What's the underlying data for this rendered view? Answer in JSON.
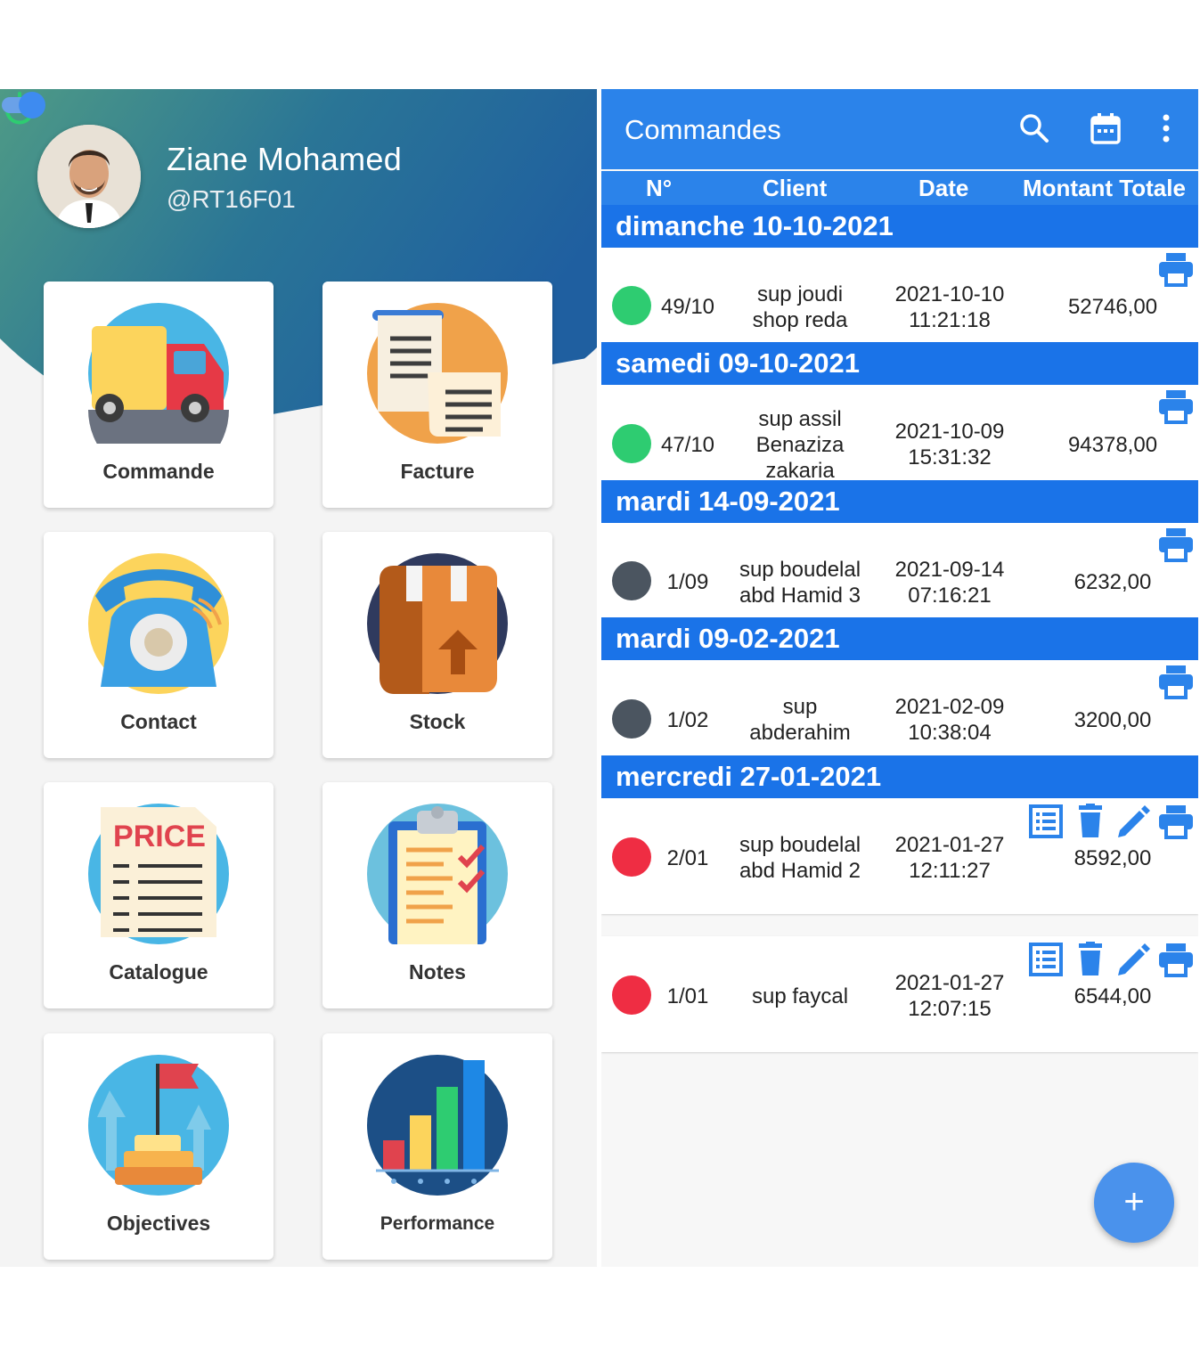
{
  "profile": {
    "name": "Ziane Mohamed",
    "handle": "@RT16F01"
  },
  "menu": [
    {
      "label": "Commande",
      "icon": "truck-icon"
    },
    {
      "label": "Facture",
      "icon": "invoice-icon"
    },
    {
      "label": "Contact",
      "icon": "telephone-icon"
    },
    {
      "label": "Stock",
      "icon": "box-icon"
    },
    {
      "label": "Catalogue",
      "icon": "price-list-icon",
      "icon_text": "PRICE"
    },
    {
      "label": "Notes",
      "icon": "clipboard-icon"
    },
    {
      "label": "Objectives",
      "icon": "target-flag-icon"
    },
    {
      "label": "Performance",
      "icon": "bar-chart-icon"
    }
  ],
  "orders_screen": {
    "title": "Commandes",
    "columns": [
      "N°",
      "Client",
      "Date",
      "Montant Totale"
    ],
    "groups": [
      {
        "day": "dimanche 10-10-2021",
        "orders": [
          {
            "num": "49/10",
            "client": [
              "sup joudi",
              "shop reda"
            ],
            "date": [
              "2021-10-10",
              "11:21:18"
            ],
            "amount": "52746,00",
            "status": "green"
          }
        ]
      },
      {
        "day": "samedi 09-10-2021",
        "orders": [
          {
            "num": "47/10",
            "client": [
              "sup assil",
              "Benaziza",
              "zakaria"
            ],
            "date": [
              "2021-10-09",
              "15:31:32"
            ],
            "amount": "94378,00",
            "status": "green"
          }
        ]
      },
      {
        "day": "mardi 14-09-2021",
        "orders": [
          {
            "num": "1/09",
            "client": [
              "sup boudelal",
              "abd Hamid 3"
            ],
            "date": [
              "2021-09-14",
              "07:16:21"
            ],
            "amount": "6232,00",
            "status": "grey"
          }
        ]
      },
      {
        "day": "mardi 09-02-2021",
        "orders": [
          {
            "num": "1/02",
            "client": [
              "sup",
              "abderahim"
            ],
            "date": [
              "2021-02-09",
              "10:38:04"
            ],
            "amount": "3200,00",
            "status": "grey"
          }
        ]
      },
      {
        "day": "mercredi 27-01-2021",
        "orders": [
          {
            "num": "2/01",
            "client": [
              "sup boudelal",
              "abd Hamid 2"
            ],
            "date": [
              "2021-01-27",
              "12:11:27"
            ],
            "amount": "8592,00",
            "status": "red"
          },
          {
            "num": "1/01",
            "client": [
              "sup faycal"
            ],
            "date": [
              "2021-01-27",
              "12:07:15"
            ],
            "amount": "6544,00",
            "status": "red"
          }
        ]
      }
    ],
    "fab_label": "+"
  },
  "colors": {
    "accent": "#2b83ea",
    "day_bar": "#1a73e8",
    "green": "#2ecc71",
    "grey": "#4b5560",
    "red": "#ef2d43"
  }
}
